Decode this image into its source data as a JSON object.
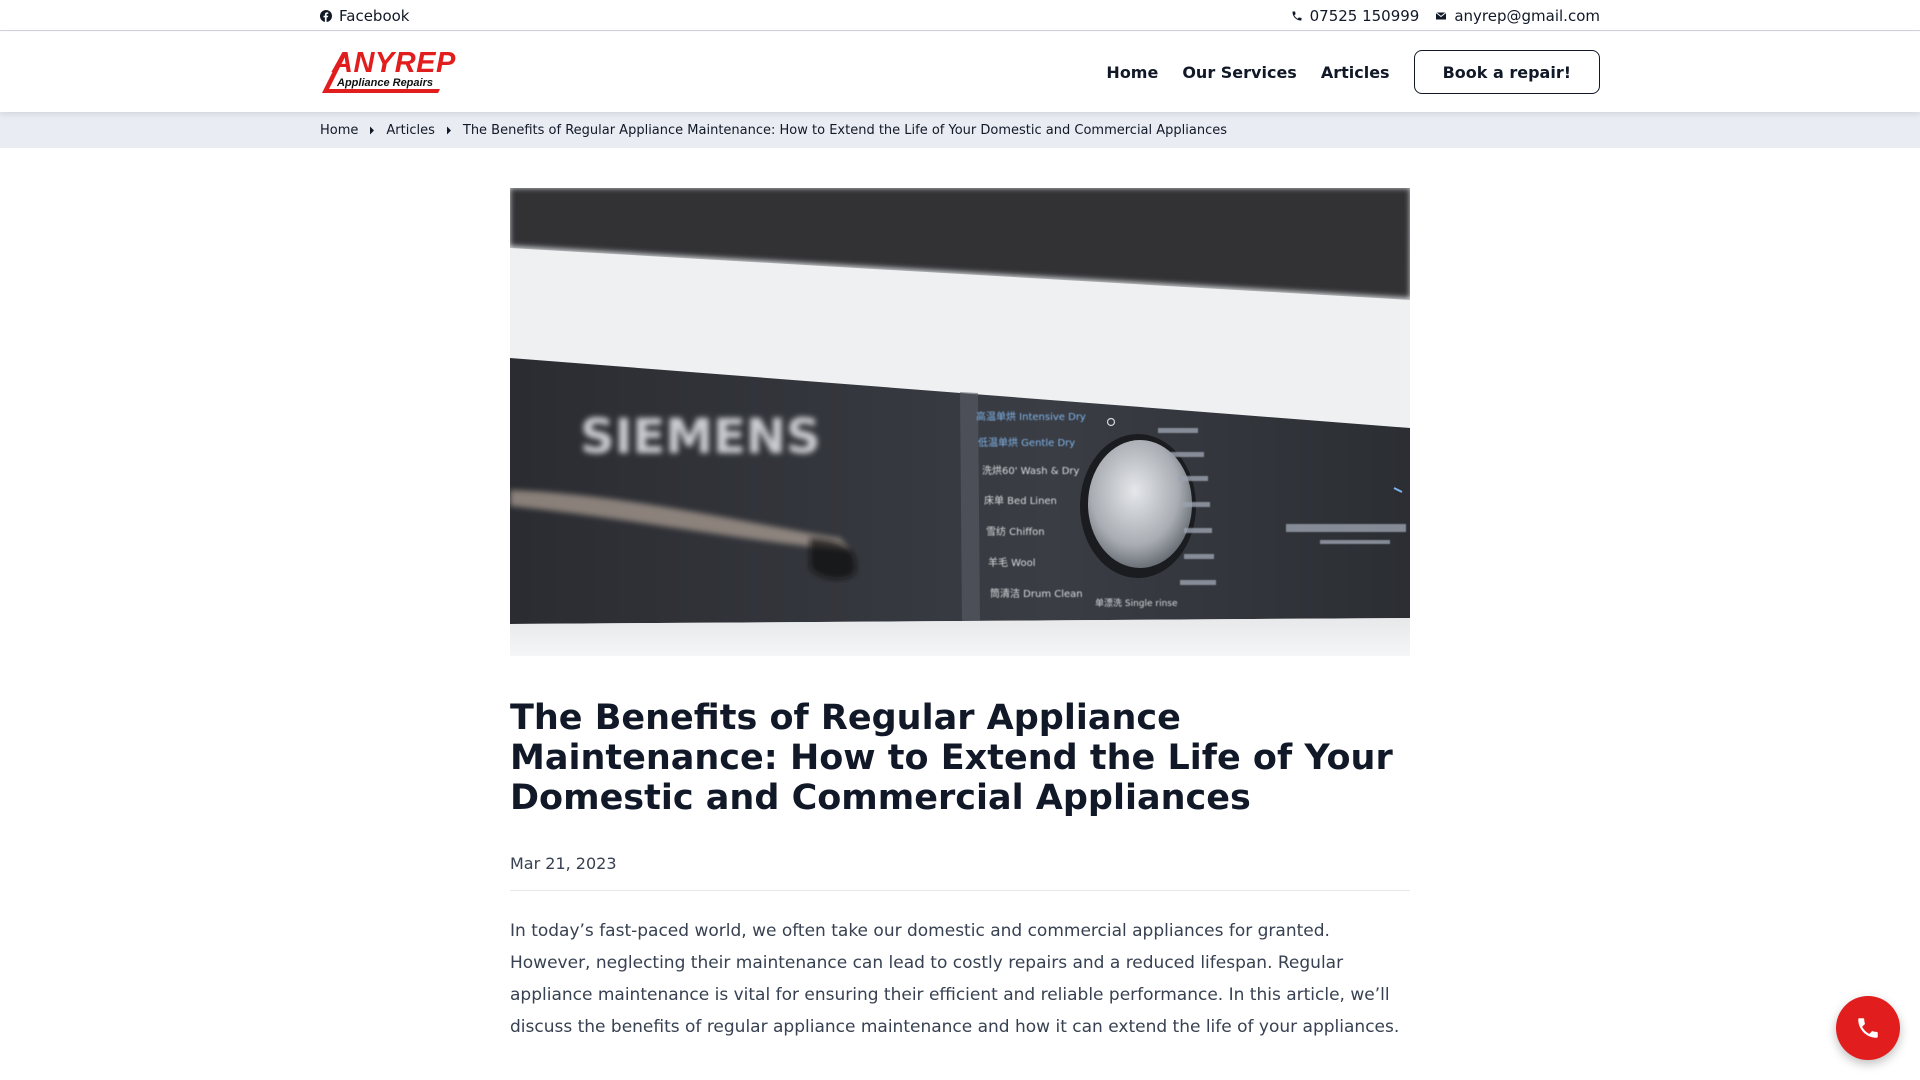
{
  "topbar": {
    "facebook_label": "Facebook",
    "phone": "07525 150999",
    "email": "anyrep@gmail.com"
  },
  "header": {
    "logo_word": "ANYREP",
    "logo_sub": "Appliance Repairs",
    "nav": [
      {
        "label": "Home"
      },
      {
        "label": "Our Services"
      },
      {
        "label": "Articles"
      }
    ],
    "cta_label": "Book a repair!"
  },
  "breadcrumb": {
    "items": [
      {
        "label": "Home"
      },
      {
        "label": "Articles"
      },
      {
        "label": "The Benefits of Regular Appliance Maintenance: How to Extend the Life of Your Domestic and Commercial Appliances"
      }
    ]
  },
  "article": {
    "hero": {
      "brand": "SIEMENS",
      "programs": [
        "高温单烘 Intensive Dry",
        "低温单烘 Gentle Dry",
        "洗烘60' Wash & Dry",
        "床单 Bed Linen",
        "雪纺 Chiffon",
        "羊毛 Wool",
        "筒清洁 Drum Clean"
      ],
      "bottom_label": "单漂洗 Single rinse"
    },
    "title": "The Benefits of Regular Appliance Maintenance: How to Extend the Life of Your Domestic and Commercial Appliances",
    "date": "Mar 21, 2023",
    "intro": "In today’s fast-paced world, we often take our domestic and commercial appliances for granted. However, neglecting their maintenance can lead to costly repairs and a reduced lifespan. Regular appliance maintenance is vital for ensuring their efficient and reliable performance. In this article, we’ll discuss the benefits of regular appliance maintenance and how it can extend the life of your appliances."
  },
  "colors": {
    "brand_red": "#e11d1d",
    "breadcrumb_bg": "#e9edf3",
    "text_dark": "#111827"
  },
  "icons": {
    "facebook": "facebook-icon",
    "phone": "phone-icon",
    "email": "envelope-icon",
    "breadcrumb_separator": "caret-right-icon",
    "fab": "phone-icon"
  }
}
